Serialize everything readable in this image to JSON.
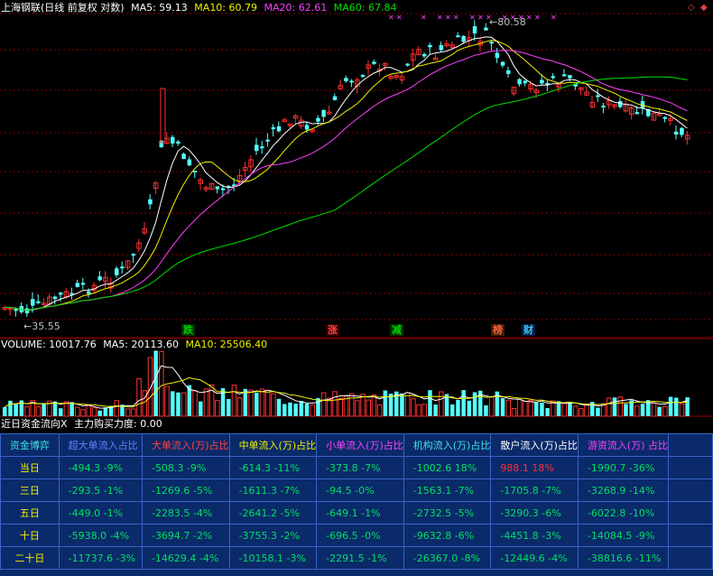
{
  "main": {
    "stock_title": "上海钢联(日线 前复权 对数)",
    "ma": [
      {
        "label": "MA5: 59.13",
        "color": "#ffffff"
      },
      {
        "label": "MA10: 60.79",
        "color": "#f0f000"
      },
      {
        "label": "MA20: 62.61",
        "color": "#ff40ff"
      },
      {
        "label": "MA60: 67.84",
        "color": "#00e000"
      }
    ],
    "high_label": "80.58",
    "low_label": "35.55",
    "markers": [
      {
        "text": "跌",
        "color": "#00d000"
      },
      {
        "text": "涨",
        "color": "#ff4040"
      },
      {
        "text": "减",
        "color": "#00d000"
      },
      {
        "text": "榜",
        "color": "#ff4040"
      },
      {
        "text": "财",
        "color": "#40c0ff"
      }
    ],
    "corner_icons": [
      "diamond-icon",
      "diamond-filled-icon"
    ]
  },
  "volume": {
    "title": "VOLUME: 10017.76",
    "ma5": "MA5: 20113.60",
    "ma10": "MA10: 25506.40"
  },
  "flow": {
    "title": "近日资金流向X",
    "buying_power": "主力购买力度: 0.00",
    "headers": [
      "资金博弈",
      "超大单流入占比",
      "大单流入(万)占比",
      "中单流入(万)占比",
      "小单流入(万)占比",
      "机构流入(万)占比",
      "散户流入(万)占比",
      "游资流入(万) 占比"
    ],
    "rows": [
      {
        "period": "当日",
        "values": [
          "-494.3 -9%",
          "-508.3 -9%",
          "-614.3 -11%",
          "-373.8 -7%",
          "-1002.6 18%",
          "988.1 18%",
          "-1990.7 -36%"
        ]
      },
      {
        "period": "三日",
        "values": [
          "-293.5 -1%",
          "-1269.6 -5%",
          "-1611.3 -7%",
          "-94.5 -0%",
          "-1563.1 -7%",
          "-1705.8 -7%",
          "-3268.9 -14%"
        ]
      },
      {
        "period": "五日",
        "values": [
          "-449.0 -1%",
          "-2283.5 -4%",
          "-2641.2 -5%",
          "-649.1 -1%",
          "-2732.5 -5%",
          "-3290.3 -6%",
          "-6022.8 -10%"
        ]
      },
      {
        "period": "十日",
        "values": [
          "-5938.0 -4%",
          "-3694.7 -2%",
          "-3755.3 -2%",
          "-696.5 -0%",
          "-9632.8 -6%",
          "-4451.8 -3%",
          "-14084.5 -9%"
        ]
      },
      {
        "period": "二十日",
        "values": [
          "-11737.6 -3%",
          "-14629.4 -4%",
          "-10158.1 -3%",
          "-2291.5 -1%",
          "-26367.0 -8%",
          "-12449.6 -4%",
          "-38816.6 -11%"
        ]
      }
    ]
  },
  "colors": {
    "up": "#ff3030",
    "down": "#54ffff",
    "grid": "#8b0000",
    "table_bg": "#0a2a6a",
    "table_border": "#3a63c8"
  }
}
